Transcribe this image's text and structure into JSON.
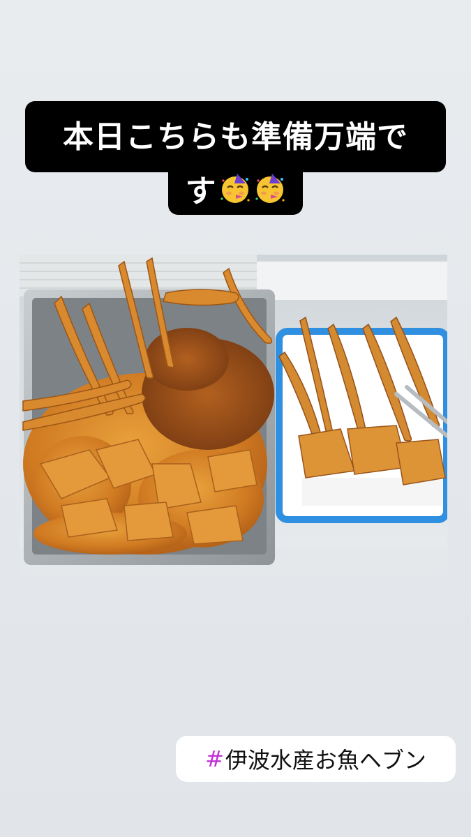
{
  "caption": {
    "line1": "本日こちらも準備万端で",
    "line2": "す",
    "emoji": [
      "party-face-emoji",
      "party-face-emoji"
    ]
  },
  "photo": {
    "subject": "fried-fish-trays"
  },
  "hashtag": {
    "symbol": "#",
    "text": "伊波水産お魚ヘブン"
  },
  "colors": {
    "caption_bg": "#000000",
    "caption_text": "#ffffff",
    "hashtag_symbol": "#c12fd6",
    "tray_blue": "#2f8fe0"
  }
}
